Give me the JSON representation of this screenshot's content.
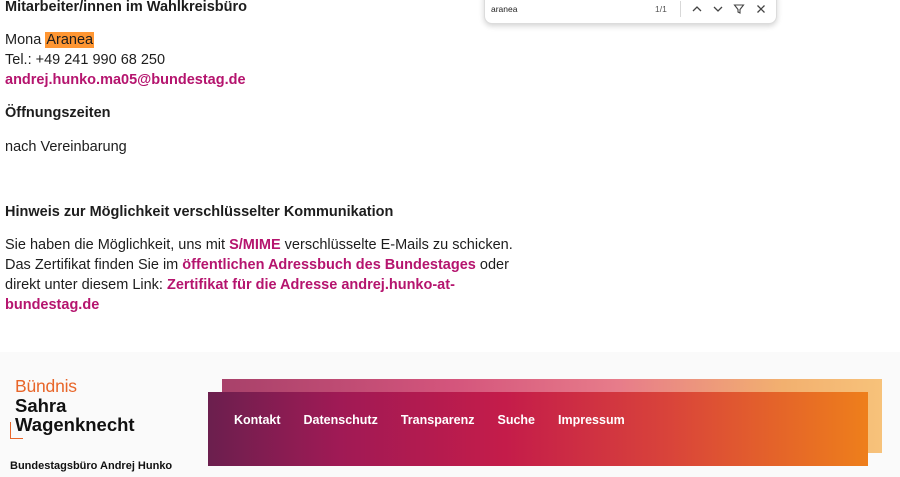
{
  "staff": {
    "heading": "Mitarbeiter/innen im Wahlkreisbüro",
    "name_first": "Mona",
    "name_last": "Aranea",
    "phone": "Tel.: +49 241 990 68 250",
    "email": "andrej.hunko.ma05@bundestag.de"
  },
  "hours": {
    "heading": "Öffnungszeiten",
    "text": "nach Vereinbarung"
  },
  "encryption": {
    "heading": "Hinweis zur Möglichkeit verschlüsselter Kommunikation",
    "text_1": "Sie haben die Möglichkeit, uns mit",
    "link_smime": "S/MIME",
    "text_2": "verschlüsselte E-Mails zu schicken. Das Zertifikat finden Sie im",
    "link_addressbook": "öffentlichen Adressbuch des Bundestages",
    "text_3": "oder direkt unter diesem Link:",
    "link_certificate": "Zertifikat für die Adresse andrej.hunko-at-bundestag.de"
  },
  "find_bar": {
    "query": "aranea",
    "count": "1/1",
    "icons": [
      "chevron-up-icon",
      "chevron-down-icon",
      "filter-icon",
      "close-icon"
    ]
  },
  "footer": {
    "logo_line1": "Bündnis",
    "logo_line2": "Sahra",
    "logo_line3": "Wagenknecht",
    "office": "Bundestagsbüro Andrej Hunko",
    "nav": [
      "Kontakt",
      "Datenschutz",
      "Transparenz",
      "Suche",
      "Impressum"
    ]
  },
  "colors": {
    "link": "#b5146e",
    "highlight": "#ff9632",
    "brand_orange": "#e8662a"
  }
}
